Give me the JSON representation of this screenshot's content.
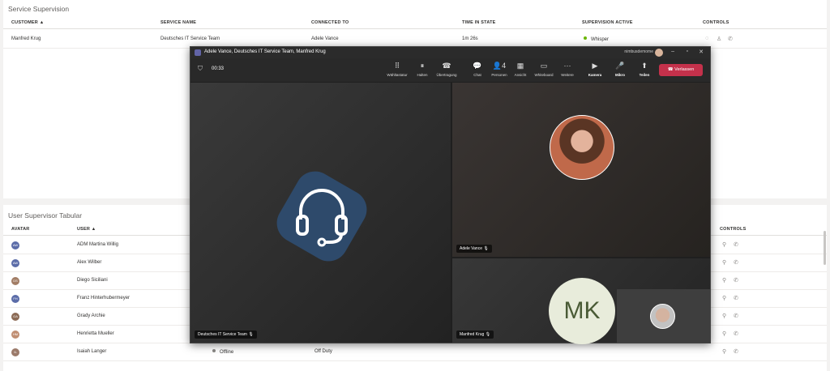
{
  "service_supervision": {
    "title": "Service Supervision",
    "columns": [
      "CUSTOMER ▲",
      "SERVICE NAME",
      "CONNECTED TO",
      "TIME IN STATE",
      "SUPERVISION ACTIVE",
      "CONTROLS"
    ],
    "row": {
      "customer": "Manfred Krug",
      "service_name": "Deutsches IT Service Team",
      "connected_to": "Adele Vance",
      "time_in_state": "1m 26s",
      "supervision_active": "Whisper"
    }
  },
  "user_supervisor": {
    "title": "User Supervisor Tabular",
    "columns": [
      "AVATAR",
      "USER ▲",
      "CONTROLS"
    ],
    "rows": [
      {
        "initials": "AW",
        "user": "ADM Martina Willig"
      },
      {
        "initials": "AW",
        "user": "Alex Wilber"
      },
      {
        "initials": "DS",
        "user": "Diego Siciliani"
      },
      {
        "initials": "FH",
        "user": "Franz Hinterhubermeyer"
      },
      {
        "initials": "GA",
        "user": "Grady Archie"
      },
      {
        "initials": "HM",
        "user": "Henrietta Mueller"
      },
      {
        "initials": "IL",
        "user": "Isaiah Langer",
        "status": "Offline",
        "state": "Off Duty"
      }
    ]
  },
  "teams": {
    "title": "Adele Vance, Deutsches IT Service Team, Manfred Krug",
    "account": "nimbusdemome",
    "timer": "00:33",
    "toolbar": [
      {
        "icon": "dialpad-icon",
        "label": "Wähltastatur",
        "glyph": "⠿"
      },
      {
        "icon": "hold-icon",
        "label": "Halten",
        "glyph": "⏸"
      },
      {
        "icon": "transfer-icon",
        "label": "Übertragung",
        "glyph": "☎"
      },
      {
        "icon": "chat-icon",
        "label": "Chat",
        "glyph": "💬"
      },
      {
        "icon": "people-icon",
        "label": "Personen",
        "glyph": "👤4"
      },
      {
        "icon": "view-icon",
        "label": "Ansicht",
        "glyph": "▦"
      },
      {
        "icon": "whiteboard-icon",
        "label": "Whiteboard",
        "glyph": "▭"
      },
      {
        "icon": "more-icon",
        "label": "Weitere",
        "glyph": "···"
      }
    ],
    "media": [
      {
        "icon": "camera-off-icon",
        "label": "Kamera",
        "glyph": "▶"
      },
      {
        "icon": "mic-icon",
        "label": "Mikro",
        "glyph": "🎤"
      },
      {
        "icon": "share-icon",
        "label": "Teilen",
        "glyph": "⬆"
      }
    ],
    "leave_label": "Verlassen",
    "tiles": {
      "service": "Deutsches IT Service Team",
      "adele": "Adele Vance",
      "manfred": "Manfred Krug",
      "manfred_initials": "MK"
    }
  }
}
